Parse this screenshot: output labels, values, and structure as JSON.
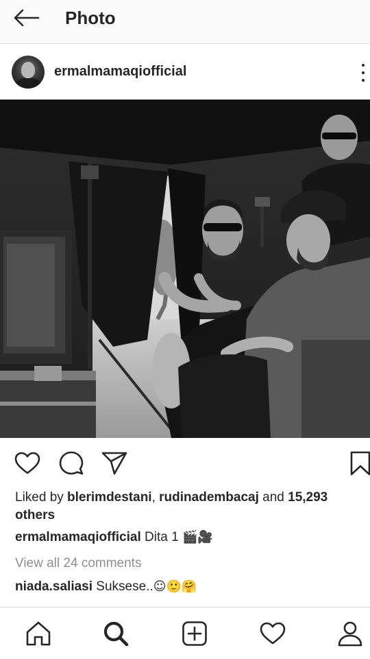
{
  "topbar": {
    "title": "Photo",
    "back_icon": "arrow-left-icon"
  },
  "post": {
    "username": "ermalmamaqiofficial",
    "menu_icon": "more-vertical-icon",
    "photo_description": "black-and-white film set photo",
    "actions": {
      "like_icon": "heart-outline-icon",
      "comment_icon": "comment-bubble-icon",
      "share_icon": "paper-plane-icon",
      "save_icon": "bookmark-icon"
    },
    "likes": {
      "prefix": "Liked by ",
      "user1": "blerimdestani",
      "separator": ", ",
      "user2": "rudinadembacaj",
      "conjunction": " and ",
      "others": "15,293 others"
    },
    "caption": {
      "username": "ermalmamaqiofficial",
      "text": "Dita 1",
      "emojis": "🎬🎥"
    },
    "view_all_comments": "View all 24 comments",
    "comments": [
      {
        "username": "niada.saliasi",
        "text": "Suksese..",
        "emojis": "☺🙂🤗"
      }
    ]
  },
  "bottom_nav": {
    "home_icon": "home-icon",
    "search_icon": "search-icon",
    "add_icon": "plus-square-icon",
    "activity_icon": "heart-outline-icon",
    "profile_icon": "user-profile-icon"
  }
}
